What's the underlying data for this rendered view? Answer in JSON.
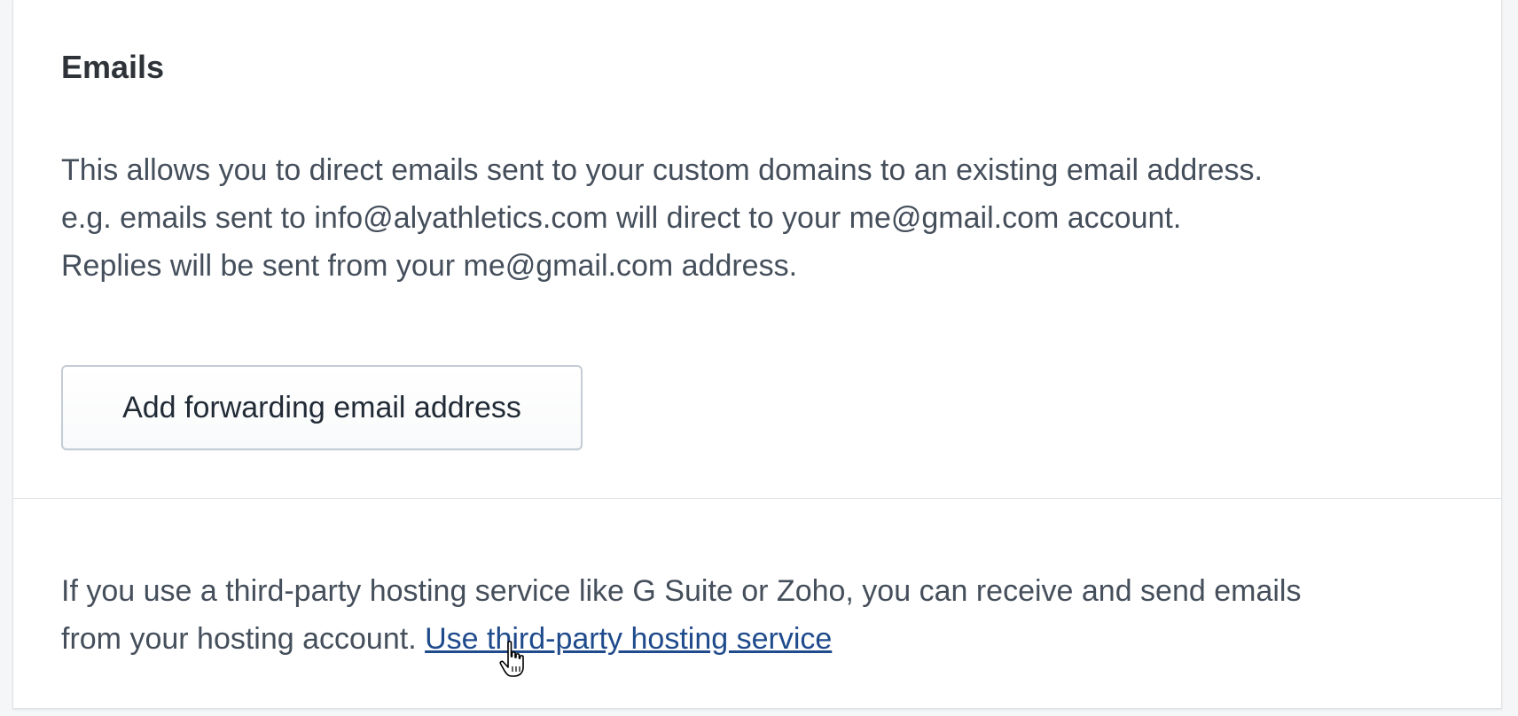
{
  "section": {
    "title": "Emails",
    "description_lines": [
      "This allows you to direct emails sent to your custom domains to an existing email address.",
      "e.g. emails sent to info@alyathletics.com will direct to your me@gmail.com account.",
      "Replies will be sent from your me@gmail.com address."
    ],
    "add_button_label": "Add forwarding email address"
  },
  "footer": {
    "text_line1": "If you use a third-party hosting service like G Suite or Zoho, you can receive and send emails",
    "text_line2_prefix": "from your hosting account. ",
    "link_label": "Use third-party hosting service"
  },
  "cursor": {
    "icon": "hand-pointer-icon"
  },
  "colors": {
    "link": "#1f4b8c",
    "text": "#454f5b",
    "title": "#2e3339",
    "border": "#c4cdd5"
  }
}
